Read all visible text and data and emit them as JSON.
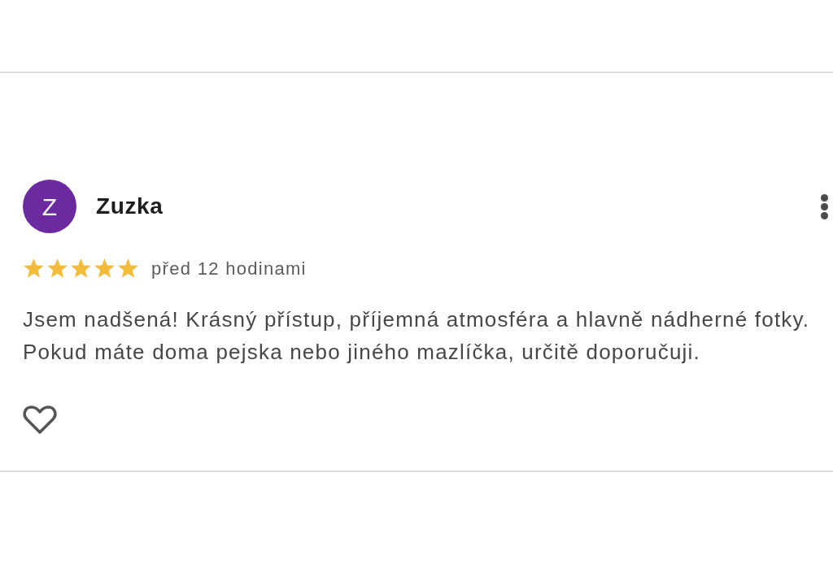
{
  "reviews": [
    {
      "avatar": {
        "letter": "Z",
        "color": "#6b2aa0"
      },
      "name": "Zuzka",
      "stars": 5,
      "time": "před 12 hodinami",
      "text": "Jsem nadšená! Krásný přístup, příjemná atmosféra a hlavně nádherné fotky. Pokud máte doma pejska nebo jiného mazlíčka, určitě doporučuji."
    }
  ]
}
